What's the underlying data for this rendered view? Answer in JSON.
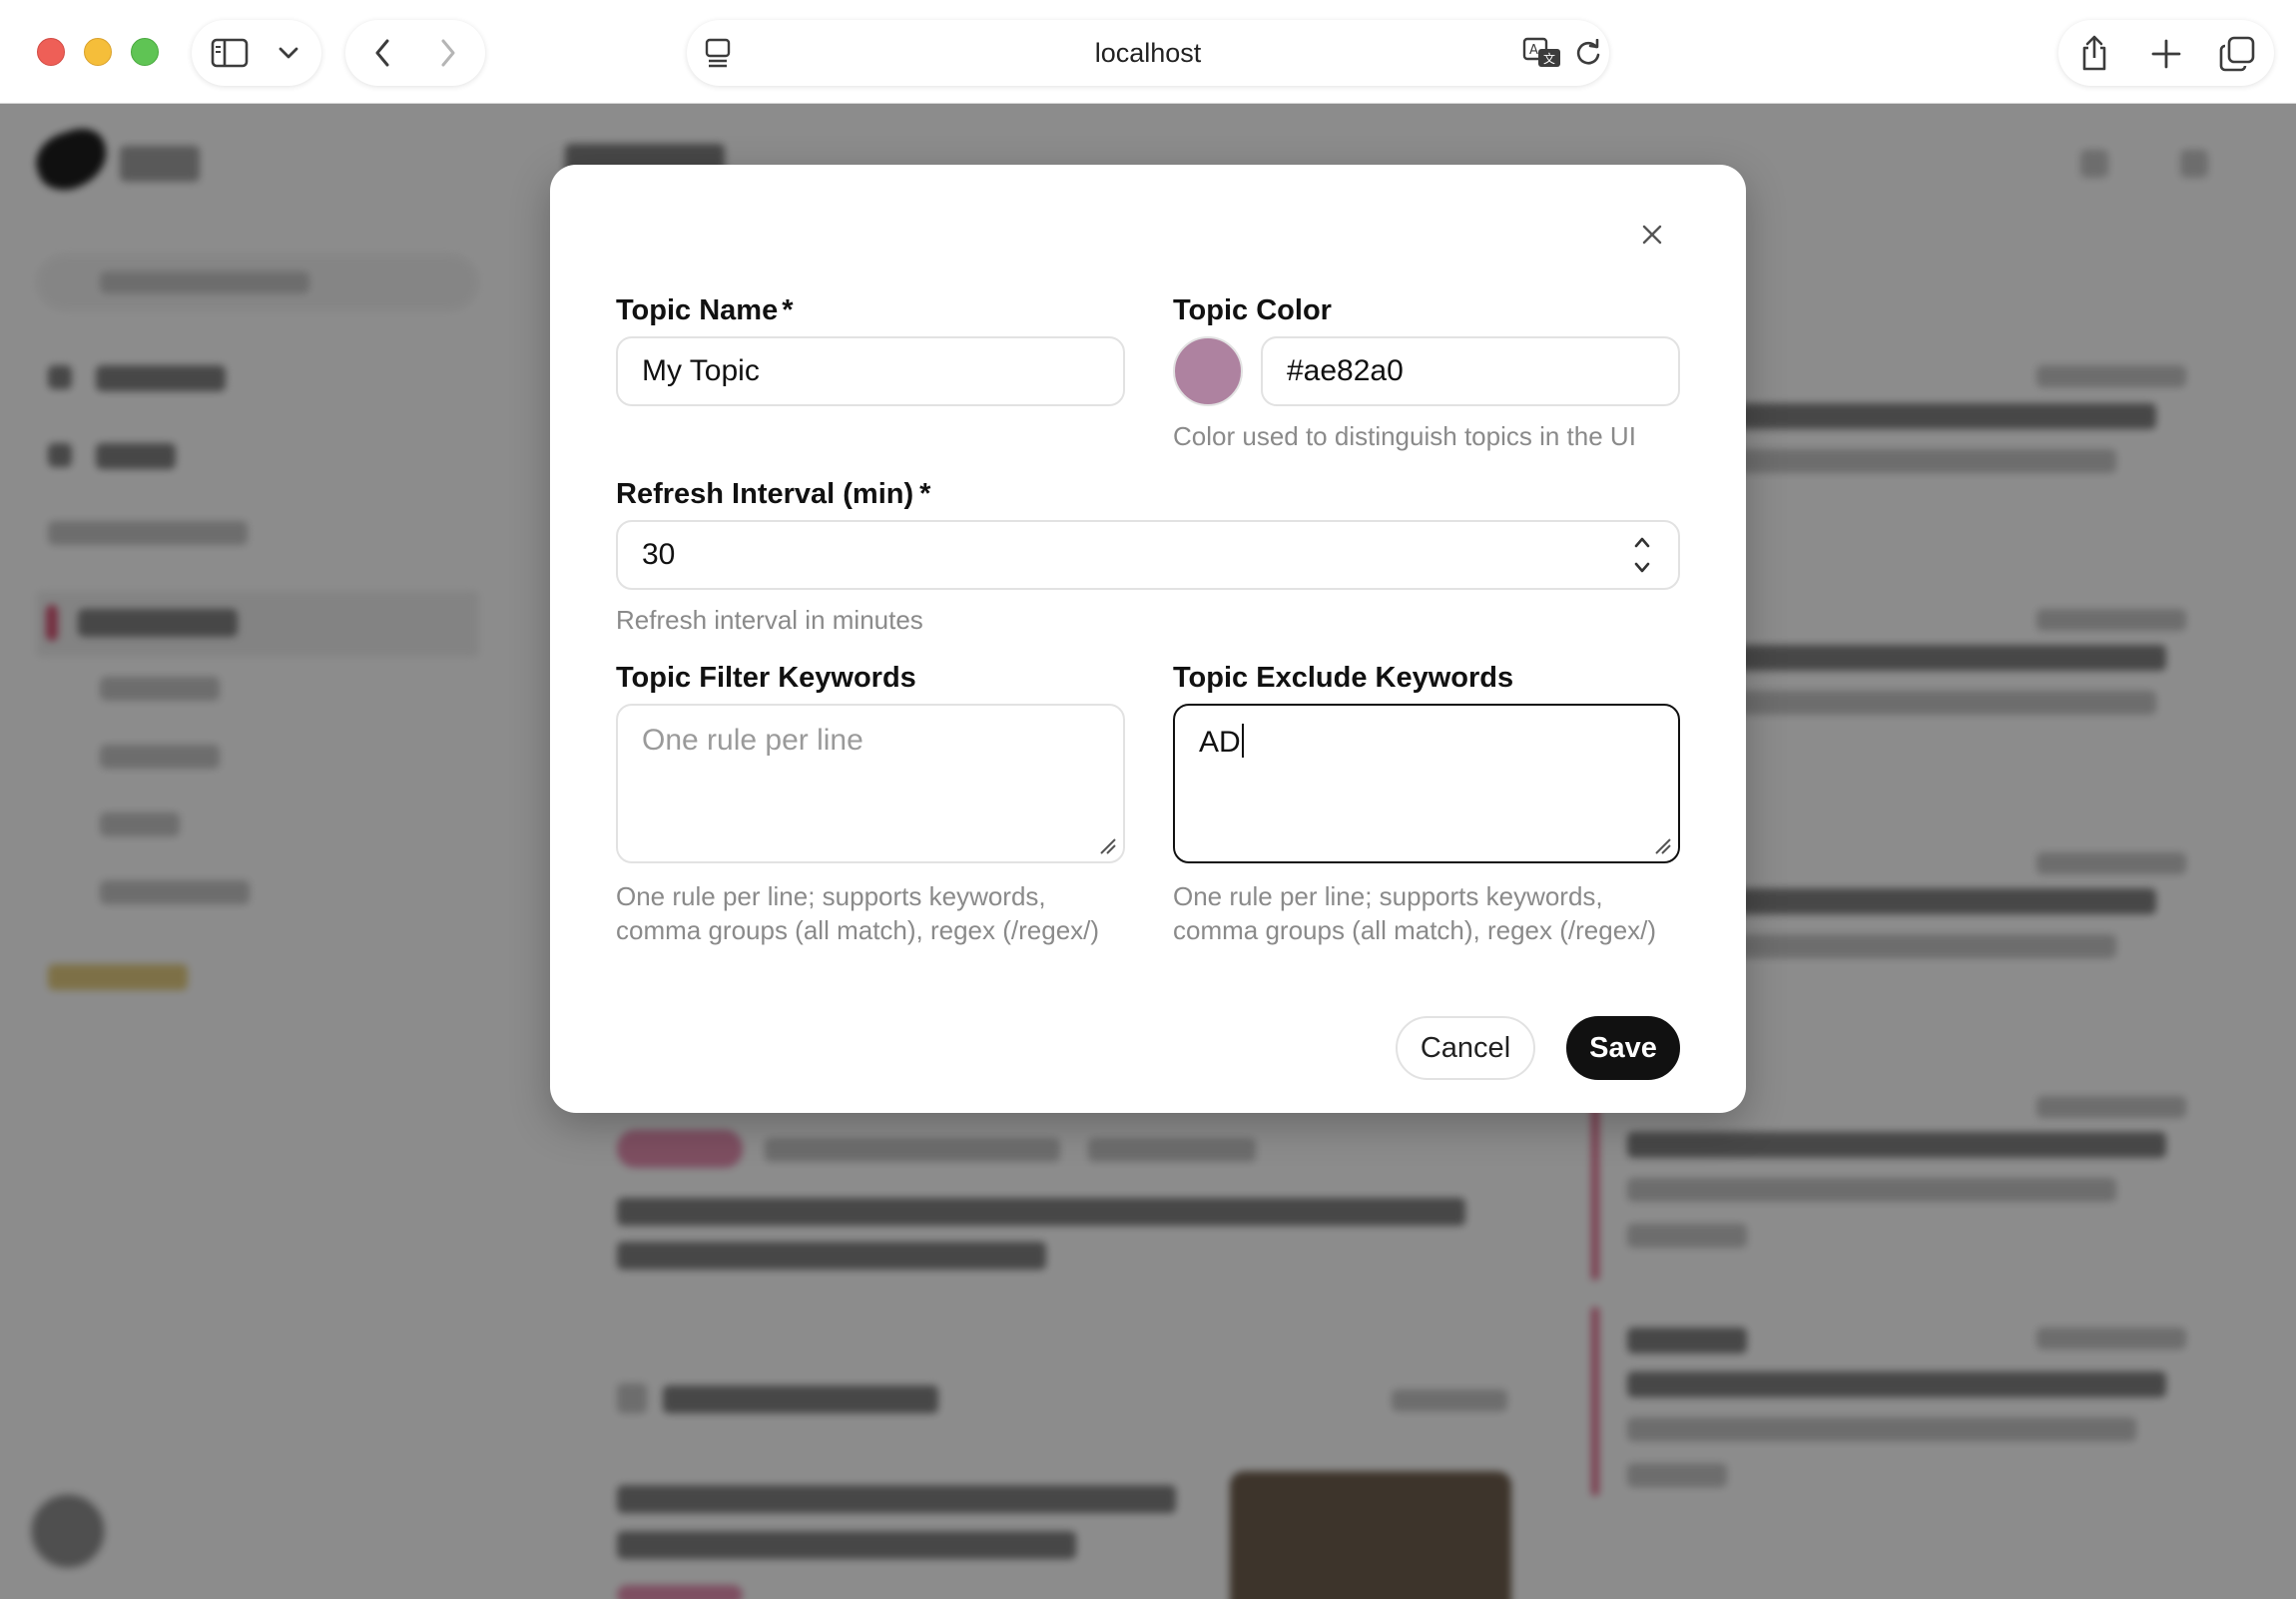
{
  "browser": {
    "address": "localhost",
    "icons": [
      "sidebar-toggle-icon",
      "chevron-down-icon",
      "back-arrow-icon",
      "forward-arrow-icon",
      "page-menu-icon",
      "translate-icon",
      "reload-icon",
      "share-icon",
      "new-tab-icon",
      "tab-overview-icon"
    ]
  },
  "modal": {
    "topic_name": {
      "label": "Topic Name",
      "required_mark": "*",
      "value": "My Topic"
    },
    "topic_color": {
      "label": "Topic Color",
      "value": "#ae82a0",
      "swatch_color": "#ae82a0",
      "help": "Color used to distinguish topics in the UI"
    },
    "refresh_interval": {
      "label": "Refresh Interval (min)",
      "required_mark": "*",
      "value": "30",
      "help": "Refresh interval in minutes"
    },
    "filter_keywords": {
      "label": "Topic Filter Keywords",
      "placeholder": "One rule per line",
      "value": "",
      "help_line1": "One rule per line; supports keywords,",
      "help_line2": "comma groups (all match), regex (/regex/)"
    },
    "exclude_keywords": {
      "label": "Topic Exclude Keywords",
      "value": "AD",
      "help_line1": "One rule per line; supports keywords,",
      "help_line2": "comma groups (all match), regex (/regex/)"
    },
    "buttons": {
      "cancel": "Cancel",
      "save": "Save"
    }
  },
  "colors": {
    "accent": "#111111",
    "topic": "#ae82a0",
    "overlay": "rgba(0,0,0,0.42)"
  }
}
